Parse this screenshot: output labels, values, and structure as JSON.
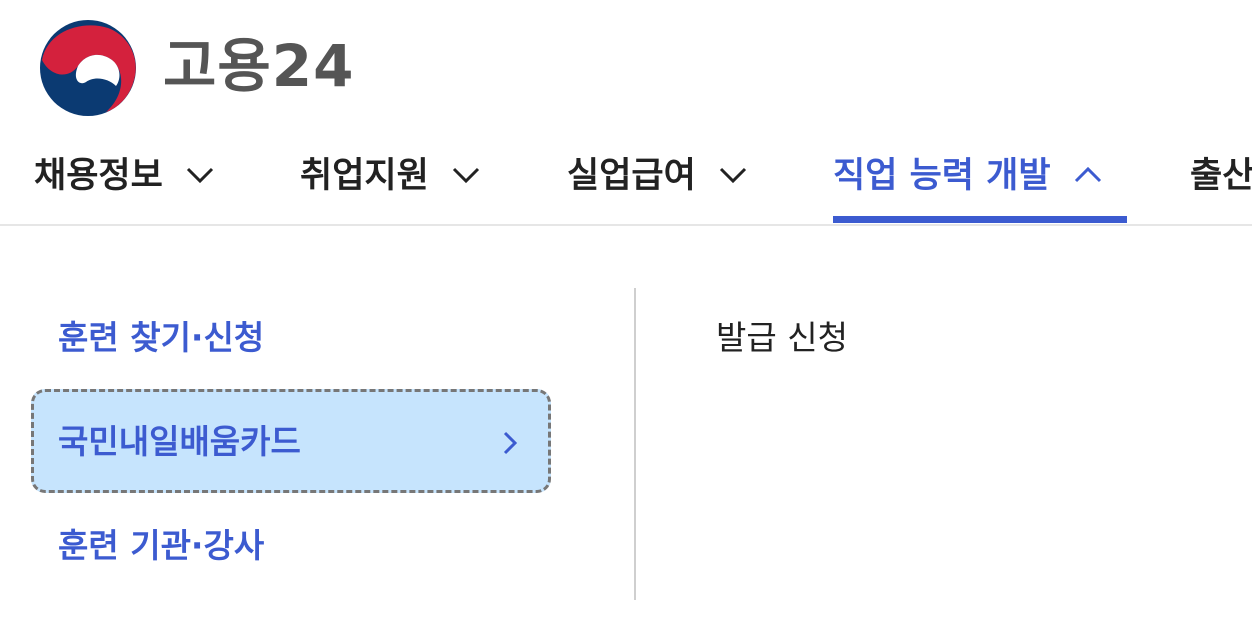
{
  "site": {
    "title": "고용24"
  },
  "nav": {
    "items": [
      {
        "label": "채용정보"
      },
      {
        "label": "취업지원"
      },
      {
        "label": "실업급여"
      },
      {
        "label": "직업 능력 개발"
      },
      {
        "label": "출산"
      }
    ],
    "active_index": 3
  },
  "submenu": {
    "left_items": [
      {
        "label": "훈련 찾기·신청"
      },
      {
        "label": "국민내일배움카드",
        "selected": true
      },
      {
        "label": "훈련 기관·강사"
      }
    ],
    "right_items": [
      {
        "label": "발급 신청"
      }
    ]
  },
  "colors": {
    "accent": "#3c5bd0",
    "selected_bg": "#c6e4fd",
    "logo_blue": "#0b3a72",
    "logo_red": "#d4213d",
    "title_gray": "#555555"
  },
  "icons": {
    "logo": "taegeuk-emblem-icon",
    "collapsed": "chevron-down-icon",
    "expanded": "chevron-up-icon",
    "submenu_arrow": "chevron-right-icon"
  }
}
